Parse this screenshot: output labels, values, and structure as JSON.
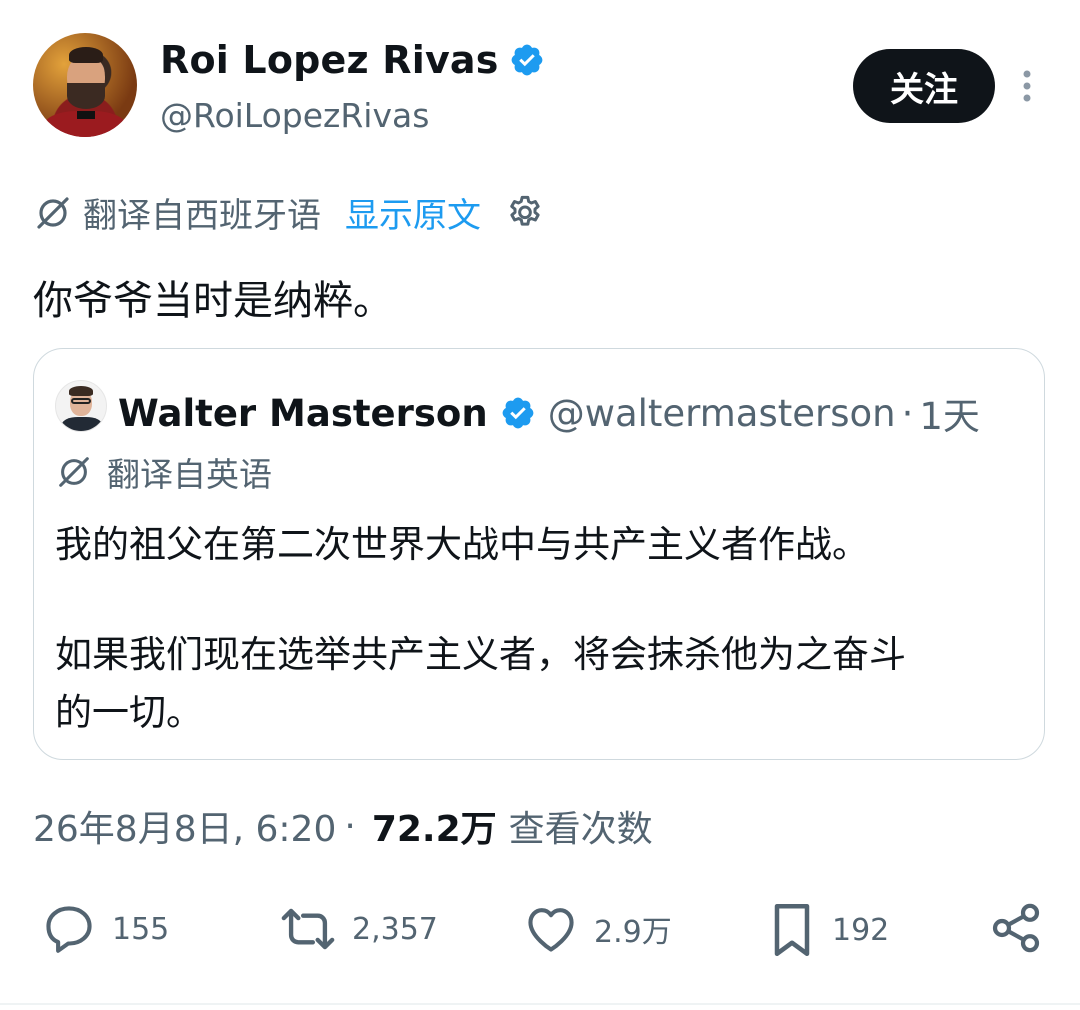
{
  "author": {
    "display_name": "Roi Lopez Rivas",
    "handle": "@RoiLopezRivas",
    "verified": true
  },
  "follow_button_label": "关注",
  "translation": {
    "label": "翻译自西班牙语",
    "show_original_label": "显示原文"
  },
  "tweet": {
    "text": "你爷爷当时是纳粹。"
  },
  "quoted_tweet": {
    "display_name": "Walter Masterson",
    "handle": "@waltermasterson",
    "separator": "·",
    "time": "1天",
    "translation_label": "翻译自英语",
    "lines": [
      "我的祖父在第二次世界大战中与共产主义者作战。",
      "如果我们现在选举共产主义者，将会抹杀他为之奋斗",
      "的一切。"
    ]
  },
  "meta": {
    "timestamp": "26年8月8日, 6:20",
    "separator": "·",
    "views_count": "72.2万",
    "views_label": "查看次数"
  },
  "actions": {
    "replies": "155",
    "retweets": "2,357",
    "likes": "2.9万",
    "bookmarks": "192"
  },
  "colors": {
    "accent": "#1d9bf0",
    "text": "#0f1419",
    "secondary": "#536471",
    "border": "#cfd9de"
  },
  "icons": [
    "verified-badge-icon",
    "more-options-icon",
    "translate-icon",
    "settings-gear-icon",
    "reply-icon",
    "retweet-icon",
    "like-icon",
    "bookmark-icon",
    "share-icon"
  ]
}
